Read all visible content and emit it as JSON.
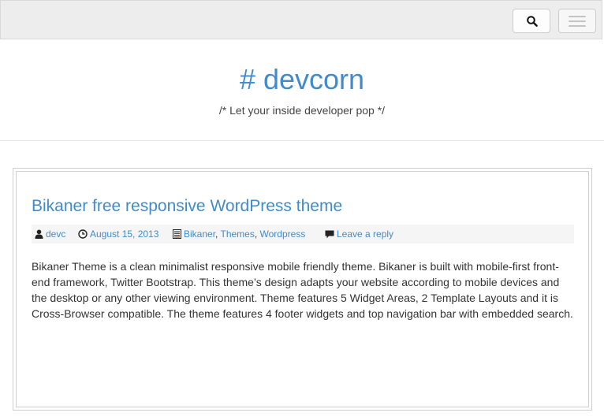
{
  "navbar": {
    "search_icon": "search-icon",
    "menu_icon": "hamburger-menu-icon"
  },
  "header": {
    "title": "# devcorn",
    "tagline": "/* Let your inside developer pop */"
  },
  "post": {
    "title": "Bikaner free responsive WordPress theme",
    "meta": {
      "author": "devc",
      "date": "August 15, 2013",
      "categories": [
        "Bikaner",
        "Themes",
        "Wordpress"
      ],
      "comments": "Leave a reply"
    },
    "body": "Bikaner Theme is a clean minimalist responsive mobile friendly theme. Bikaner is built with mobile-first front-end framework, Twitter Bootstrap. This theme’s design adapts your website according to mobile devices and the desktop or any other viewing environment. Theme features 5 Widget Areas, 2 Template Layouts and it is Cross-Browser compatible. The theme features 4 footer widgets and top navigation bar with embedded search."
  },
  "colors": {
    "link": "#428bca",
    "navbar_bg": "#ededed"
  }
}
